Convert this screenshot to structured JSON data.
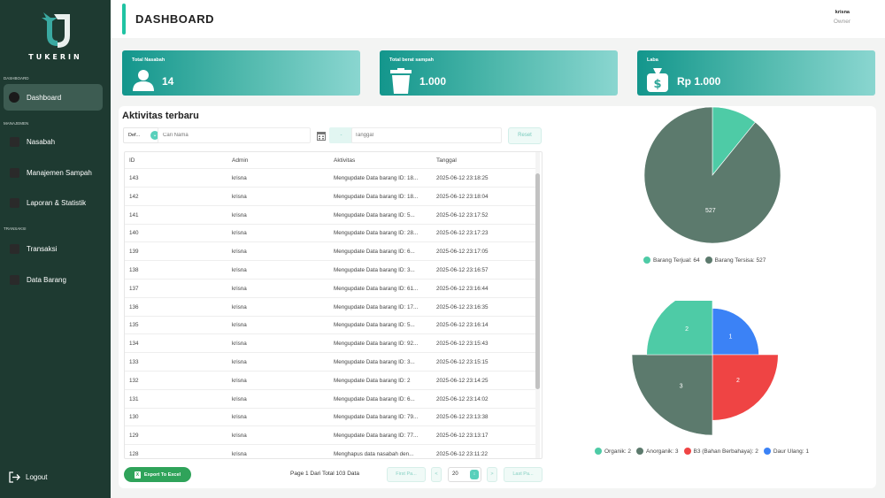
{
  "app": {
    "name": "TUKERIN"
  },
  "sidebar": {
    "sections": [
      "DASHBOARD",
      "MANAJEMEN",
      "TRANSAKSI"
    ],
    "items": [
      {
        "label": "Dashboard",
        "icon": "dashboard-icon"
      },
      {
        "label": "Nasabah",
        "icon": "user-icon"
      },
      {
        "label": "Manajemen Sampah",
        "icon": "trash-icon"
      },
      {
        "label": "Laporan & Statistik",
        "icon": "report-icon"
      },
      {
        "label": "Transaksi",
        "icon": "transaction-icon"
      },
      {
        "label": "Data Barang",
        "icon": "box-icon"
      }
    ],
    "logout": "Logout"
  },
  "header": {
    "title": "DASHBOARD",
    "user_name": "krisna",
    "user_role": "Owner"
  },
  "cards": [
    {
      "label": "Total Nasabah",
      "value": "14",
      "icon": "user-icon"
    },
    {
      "label": "Total berat sampah",
      "value": "1.000",
      "icon": "trash-icon"
    },
    {
      "label": "Laba",
      "value": "Rp 1.000",
      "icon": "money-bag-icon"
    }
  ],
  "activity": {
    "title": "Aktivitas terbaru",
    "filter_value": "Def...",
    "search_placeholder": "Cari Nama",
    "date_dropdown": "-",
    "date_placeholder": "Tanggal",
    "reset": "Reset",
    "columns": [
      "ID",
      "Admin",
      "Aktivitas",
      "Tanggal"
    ],
    "rows": [
      [
        "143",
        "krisna",
        "Mengupdate Data barang ID: 18...",
        "2025-06-12 23:18:25"
      ],
      [
        "142",
        "krisna",
        "Mengupdate Data barang ID: 18...",
        "2025-06-12 23:18:04"
      ],
      [
        "141",
        "krisna",
        "Mengupdate Data barang ID: 5...",
        "2025-06-12 23:17:52"
      ],
      [
        "140",
        "krisna",
        "Mengupdate Data barang ID: 28...",
        "2025-06-12 23:17:23"
      ],
      [
        "139",
        "krisna",
        "Mengupdate Data barang ID: 6...",
        "2025-06-12 23:17:05"
      ],
      [
        "138",
        "krisna",
        "Mengupdate Data barang ID: 3...",
        "2025-06-12 23:16:57"
      ],
      [
        "137",
        "krisna",
        "Mengupdate Data barang ID: 61...",
        "2025-06-12 23:16:44"
      ],
      [
        "136",
        "krisna",
        "Mengupdate Data barang ID: 17...",
        "2025-06-12 23:16:35"
      ],
      [
        "135",
        "krisna",
        "Mengupdate Data barang ID: 5...",
        "2025-06-12 23:16:14"
      ],
      [
        "134",
        "krisna",
        "Mengupdate Data barang ID: 92...",
        "2025-06-12 23:15:43"
      ],
      [
        "133",
        "krisna",
        "Mengupdate Data barang ID: 3...",
        "2025-06-12 23:15:15"
      ],
      [
        "132",
        "krisna",
        "Mengupdate Data barang ID: 2",
        "2025-06-12 23:14:25"
      ],
      [
        "131",
        "krisna",
        "Mengupdate Data barang ID: 6...",
        "2025-06-12 23:14:02"
      ],
      [
        "130",
        "krisna",
        "Mengupdate Data barang ID: 79...",
        "2025-06-12 23:13:38"
      ],
      [
        "129",
        "krisna",
        "Mengupdate Data barang ID: 77...",
        "2025-06-12 23:13:17"
      ],
      [
        "128",
        "krisna",
        "Menghapus data nasabah den...",
        "2025-06-12 23:11:22"
      ]
    ],
    "export": "Export To Excel",
    "page_info": "Page 1 Dari Total 103 Data",
    "first_page": "First Pa...",
    "prev": "<",
    "page_size": "20",
    "next": ">",
    "last_page": "Last Pa..."
  },
  "colors": {
    "sidebar": "#1e3a31",
    "accent": "#20c3a3",
    "teal": "#4ecba6",
    "slate": "#5c7a6d",
    "red": "#ef4444",
    "blue": "#3b82f6"
  },
  "chart_data": [
    {
      "type": "pie",
      "categories": [
        "Barang Terjual",
        "Barang Tersisa"
      ],
      "values": [
        64,
        527
      ],
      "legend": [
        "Barang Terjual: 64",
        "Barang Tersisa: 527"
      ],
      "data_labels": [
        "",
        "527"
      ],
      "colors": [
        "#4ecba6",
        "#5c7a6d"
      ]
    },
    {
      "type": "pie",
      "categories": [
        "Organik",
        "Anorganik",
        "B3 (Bahan Berbahaya)",
        "Daur Ulang"
      ],
      "values": [
        2,
        3,
        2,
        1
      ],
      "legend": [
        "Organik: 2",
        "Anorganik: 3",
        "B3 (Bahan Berbahaya): 2",
        "Daur Ulang: 1"
      ],
      "data_labels": [
        "2",
        "3",
        "2",
        "1"
      ],
      "colors": [
        "#4ecba6",
        "#5c7a6d",
        "#ef4444",
        "#3b82f6"
      ]
    }
  ]
}
